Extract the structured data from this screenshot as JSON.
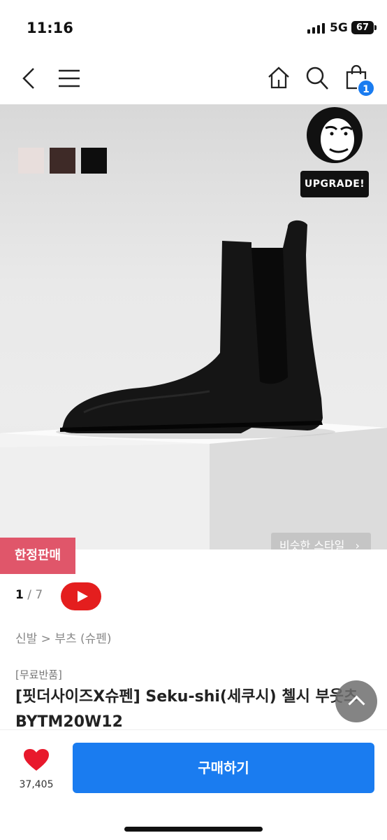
{
  "status_bar": {
    "time": "11:16",
    "network": "5G",
    "battery": "67"
  },
  "nav": {
    "back_icon": "chevron-left-icon",
    "menu_icon": "hamburger-menu-icon",
    "home_icon": "home-icon",
    "search_icon": "search-icon",
    "cart_icon": "shopping-bag-icon",
    "cart_count": "1"
  },
  "product_image": {
    "swatches": [
      "#e8dedc",
      "#3e2a27",
      "#0d0d0d"
    ],
    "upgrade_label": "UPGRADE!",
    "similar_style_label": "비슷한 스타일",
    "limited_label": "한정판매"
  },
  "pager": {
    "current": "1",
    "separator": "/",
    "total": "7"
  },
  "breadcrumb": "신발 > 부츠 (슈펜)",
  "product": {
    "tag": "[무료반품]",
    "title": "[핏더사이즈X슈펜] Seku-shi(세쿠시) 첼시 부웃츠 BYTM20W12"
  },
  "bottom_bar": {
    "like_count": "37,405",
    "buy_label": "구매하기"
  },
  "colors": {
    "accent": "#1a7cf0",
    "limited": "#e0566a",
    "like": "#e8192c",
    "youtube": "#e41e1e"
  }
}
